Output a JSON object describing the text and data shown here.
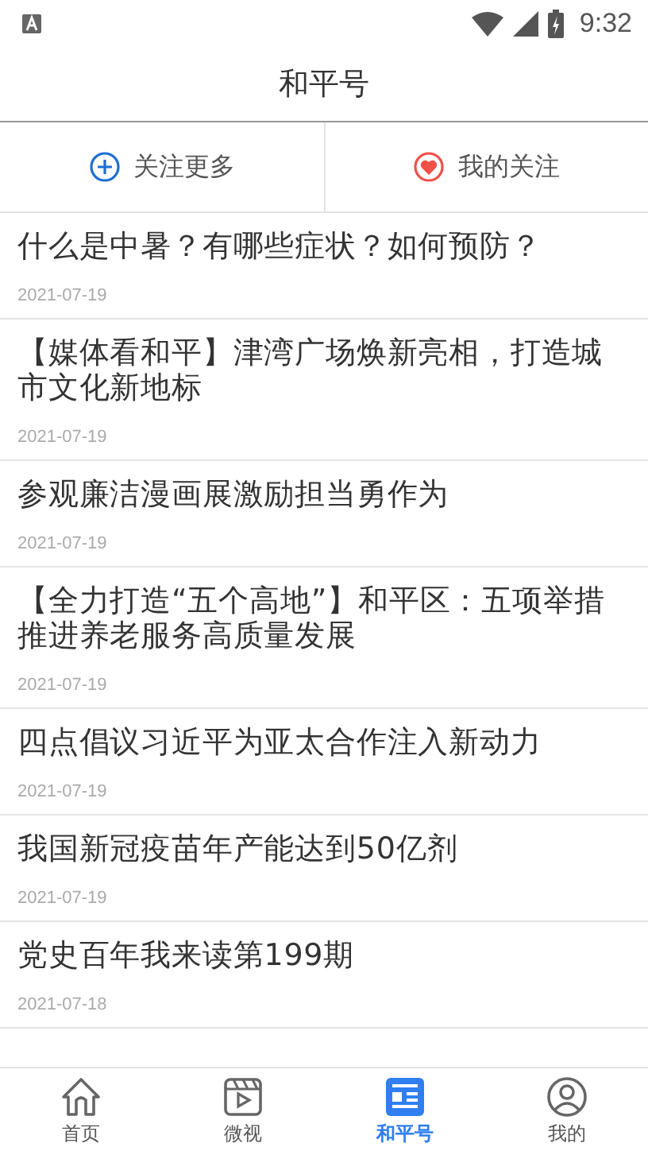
{
  "status_bar": {
    "time": "9:32"
  },
  "header": {
    "title": "和平号"
  },
  "actions": [
    {
      "kind": "add",
      "label": "关注更多"
    },
    {
      "kind": "heart",
      "label": "我的关注"
    }
  ],
  "articles": [
    {
      "title": "什么是中暑？有哪些症状？如何预防？",
      "date": "2021-07-19"
    },
    {
      "title": "【媒体看和平】津湾广场焕新亮相，打造城市文化新地标",
      "date": "2021-07-19"
    },
    {
      "title": "参观廉洁漫画展激励担当勇作为",
      "date": "2021-07-19"
    },
    {
      "title": "【全力打造“五个高地”】和平区：五项举措推进养老服务高质量发展",
      "date": "2021-07-19"
    },
    {
      "title": "四点倡议习近平为亚太合作注入新动力",
      "date": "2021-07-19"
    },
    {
      "title": "我国新冠疫苗年产能达到50亿剂",
      "date": "2021-07-19"
    },
    {
      "title": "党史百年我来读第199期",
      "date": "2021-07-18"
    }
  ],
  "tabs": [
    {
      "kind": "home",
      "label": "首页",
      "selected": false
    },
    {
      "kind": "video",
      "label": "微视",
      "selected": false
    },
    {
      "kind": "news",
      "label": "和平号",
      "selected": true
    },
    {
      "kind": "profile",
      "label": "我的",
      "selected": false
    }
  ]
}
